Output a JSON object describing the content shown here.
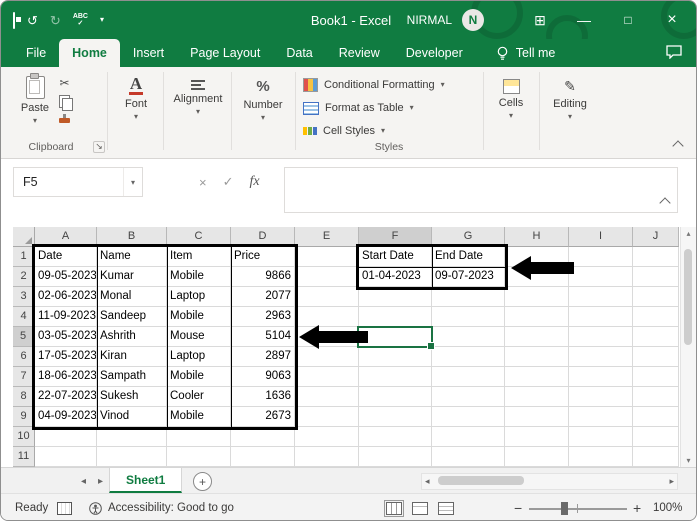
{
  "colors": {
    "excel_green": "#107C41",
    "selection_green": "#1A7343",
    "annotation_black": "#000000"
  },
  "window": {
    "title": "Book1  -  Excel",
    "user": "NIRMAL",
    "avatar": "N"
  },
  "quick_access": {
    "spelling_label": "ABC"
  },
  "tabs": {
    "items": [
      "File",
      "Home",
      "Insert",
      "Page Layout",
      "Data",
      "Review",
      "Developer"
    ],
    "active": "Home",
    "tell_me": "Tell me"
  },
  "ribbon": {
    "paste_label": "Paste",
    "clipboard_label": "Clipboard",
    "font_label": "Font",
    "alignment_label": "Alignment",
    "number_label": "Number",
    "styles": {
      "conditional_formatting": "Conditional Formatting",
      "format_as_table": "Format as Table",
      "cell_styles": "Cell Styles",
      "group_label": "Styles"
    },
    "cells_label": "Cells",
    "editing_label": "Editing"
  },
  "formula_bar": {
    "name_box": "F5",
    "fx": "fx",
    "formula": ""
  },
  "grid": {
    "column_headers": [
      "A",
      "B",
      "C",
      "D",
      "E",
      "F",
      "G",
      "H",
      "I",
      "J"
    ],
    "row_headers": [
      "1",
      "2",
      "3",
      "4",
      "5",
      "6",
      "7",
      "8",
      "9",
      "10",
      "11"
    ],
    "selected_cell": "F5",
    "right_aligned_columns": [
      "D"
    ],
    "cells": {
      "A1": "Date",
      "B1": "Name",
      "C1": "Item",
      "D1": "Price",
      "F1": "Start Date",
      "G1": "End Date",
      "A2": "09-05-2023",
      "B2": "Kumar",
      "C2": "Mobile",
      "D2": "9866",
      "F2": "01-04-2023",
      "G2": "09-07-2023",
      "A3": "02-06-2023",
      "B3": "Monal",
      "C3": "Laptop",
      "D3": "2077",
      "A4": "11-09-2023",
      "B4": "Sandeep",
      "C4": "Mobile",
      "D4": "2963",
      "A5": "03-05-2023",
      "B5": "Ashrith",
      "C5": "Mouse",
      "D5": "5104",
      "A6": "17-05-2023",
      "B6": "Kiran",
      "C6": "Laptop",
      "D6": "2897",
      "A7": "18-06-2023",
      "B7": "Sampath",
      "C7": "Mobile",
      "D7": "9063",
      "A8": "22-07-2023",
      "B8": "Sukesh",
      "C8": "Cooler",
      "D8": "1636",
      "A9": "04-09-2023",
      "B9": "Vinod",
      "C9": "Mobile",
      "D9": "2673"
    }
  },
  "sheet_bar": {
    "active_tab": "Sheet1"
  },
  "status_bar": {
    "mode": "Ready",
    "accessibility": "Accessibility: Good to go",
    "zoom": "100%"
  }
}
